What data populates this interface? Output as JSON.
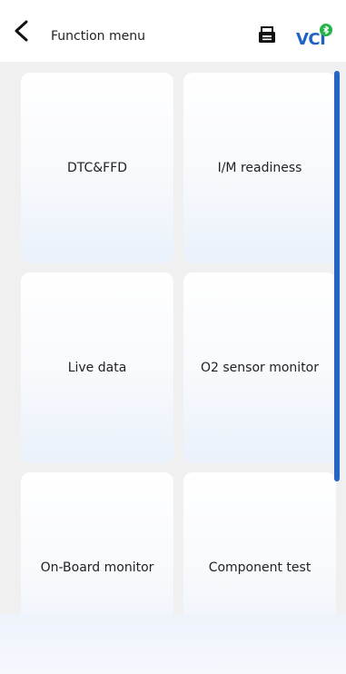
{
  "header": {
    "title": "Function menu",
    "back_icon": "chevron-left-icon",
    "print_icon": "printer-icon",
    "vci": {
      "label": "VCI",
      "status_icon": "bluetooth-connected-icon",
      "text_color": "#1f62c2",
      "status_color": "#25b34a"
    }
  },
  "menu": {
    "items": [
      {
        "label": "DTC&FFD"
      },
      {
        "label": "I/M readiness"
      },
      {
        "label": "Live data"
      },
      {
        "label": "O2 sensor monitor"
      },
      {
        "label": "On-Board monitor"
      },
      {
        "label": "Component test"
      }
    ]
  },
  "colors": {
    "accent": "#2765c4",
    "background": "#f0f0f0"
  }
}
